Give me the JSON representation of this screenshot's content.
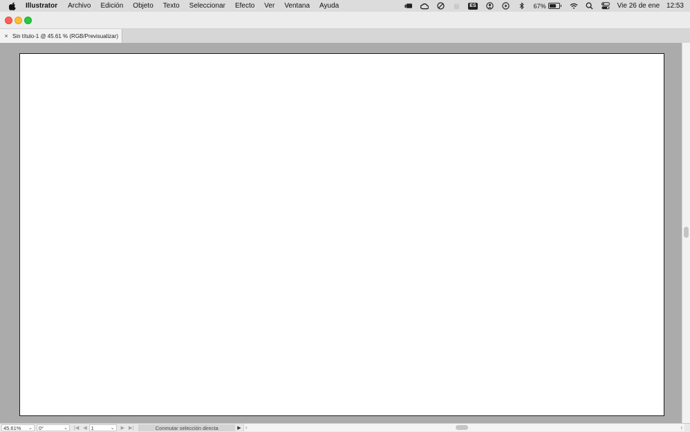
{
  "menubar": {
    "app_name": "Illustrator",
    "items": [
      "Archivo",
      "Edición",
      "Objeto",
      "Texto",
      "Seleccionar",
      "Efecto",
      "Ver",
      "Ventana",
      "Ayuda"
    ],
    "status": {
      "icons": [
        "stage-manager-icon",
        "creative-cloud-icon",
        "focus-icon",
        "cat-icon",
        "input-source-icon",
        "user-icon",
        "play-icon",
        "bluetooth-icon",
        "battery-icon",
        "wifi-icon",
        "spotlight-search-icon",
        "control-center-icon"
      ],
      "input_source": "ES",
      "battery_percent": "67%",
      "battery_level": 0.67,
      "date": "Vie 26 de ene",
      "time": "12:53"
    }
  },
  "document": {
    "tab_title": "Sin título-1 @ 45.61 % (RGB/Previsualizar)",
    "tab_close": "×"
  },
  "statusbar": {
    "zoom": "45.61%",
    "rotation": "0°",
    "artboard_number": "1",
    "status_text": "Conmutar selección directa"
  },
  "colors": {
    "canvas_background": "#ababab",
    "artboard": "#ffffff",
    "close_button": "#fe5f57",
    "minimize_button": "#febc2e",
    "zoom_button": "#28c840"
  }
}
